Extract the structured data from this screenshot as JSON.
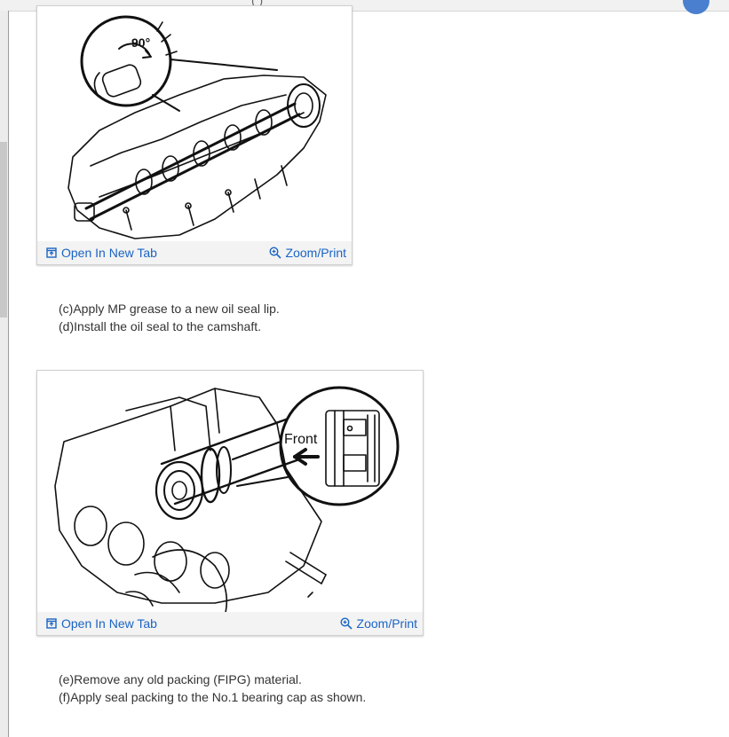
{
  "figures": [
    {
      "overlay_label": "90°",
      "open_label": "Open In New Tab",
      "zoom_label": "Zoom/Print"
    },
    {
      "overlay_label": "Front",
      "open_label": "Open In New Tab",
      "zoom_label": "Zoom/Print"
    }
  ],
  "steps_1": [
    "(c)Apply MP grease to a new oil seal lip.",
    "(d)Install the oil seal to the camshaft."
  ],
  "steps_2": [
    "(e)Remove any old packing (FIPG) material.",
    "(f)Apply seal packing to the No.1 bearing cap as shown."
  ],
  "icons": {
    "open": "open-new-tab-icon",
    "zoom": "zoom-in-icon"
  },
  "colors": {
    "link": "#1a64c4"
  }
}
